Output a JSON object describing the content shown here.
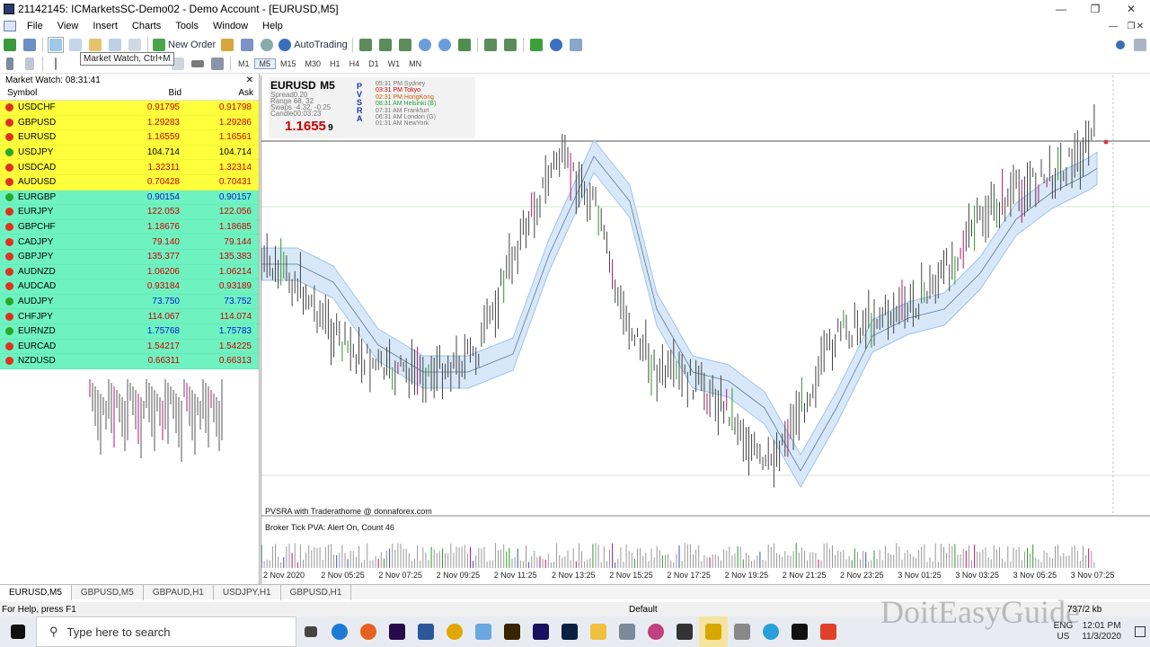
{
  "window": {
    "title": "21142145: ICMarketsSC-Demo02 - Demo Account - [EURUSD,M5]"
  },
  "menu": [
    "File",
    "View",
    "Insert",
    "Charts",
    "Tools",
    "Window",
    "Help"
  ],
  "toolbar": {
    "new_order": "New Order",
    "autotrading": "AutoTrading",
    "tooltip": "Market Watch, Ctrl+M"
  },
  "timeframes": [
    "M1",
    "M5",
    "M15",
    "M30",
    "H1",
    "H4",
    "D1",
    "W1",
    "MN"
  ],
  "market_watch": {
    "title": "Market Watch: 08:31:41",
    "headers": {
      "symbol": "Symbol",
      "bid": "Bid",
      "ask": "Ask"
    },
    "rows": [
      {
        "symbol": "USDCHF",
        "bid": "0.91795",
        "ask": "0.91798",
        "bg": "#ffff3b",
        "bid_color": "#c00",
        "ask_color": "#c00",
        "dir": "down"
      },
      {
        "symbol": "GBPUSD",
        "bid": "1.29283",
        "ask": "1.29286",
        "bg": "#ffff3b",
        "bid_color": "#c00",
        "ask_color": "#c00",
        "dir": "down"
      },
      {
        "symbol": "EURUSD",
        "bid": "1.16559",
        "ask": "1.16561",
        "bg": "#ffff3b",
        "bid_color": "#c00",
        "ask_color": "#c00",
        "dir": "down"
      },
      {
        "symbol": "USDJPY",
        "bid": "104.714",
        "ask": "104.714",
        "bg": "#ffff3b",
        "bid_color": "#000",
        "ask_color": "#000",
        "dir": "up"
      },
      {
        "symbol": "USDCAD",
        "bid": "1.32311",
        "ask": "1.32314",
        "bg": "#ffff3b",
        "bid_color": "#c00",
        "ask_color": "#c00",
        "dir": "down"
      },
      {
        "symbol": "AUDUSD",
        "bid": "0.70428",
        "ask": "0.70431",
        "bg": "#ffff3b",
        "bid_color": "#c00",
        "ask_color": "#c00",
        "dir": "down"
      },
      {
        "symbol": "EURGBP",
        "bid": "0.90154",
        "ask": "0.90157",
        "bg": "#6ef2c0",
        "bid_color": "#0019d8",
        "ask_color": "#0019d8",
        "dir": "up"
      },
      {
        "symbol": "EURJPY",
        "bid": "122.053",
        "ask": "122.056",
        "bg": "#6ef2c0",
        "bid_color": "#c00",
        "ask_color": "#c00",
        "dir": "down"
      },
      {
        "symbol": "GBPCHF",
        "bid": "1.18676",
        "ask": "1.18685",
        "bg": "#6ef2c0",
        "bid_color": "#c00",
        "ask_color": "#c00",
        "dir": "down"
      },
      {
        "symbol": "CADJPY",
        "bid": "79.140",
        "ask": "79.144",
        "bg": "#6ef2c0",
        "bid_color": "#c00",
        "ask_color": "#c00",
        "dir": "down"
      },
      {
        "symbol": "GBPJPY",
        "bid": "135.377",
        "ask": "135.383",
        "bg": "#6ef2c0",
        "bid_color": "#c00",
        "ask_color": "#c00",
        "dir": "down"
      },
      {
        "symbol": "AUDNZD",
        "bid": "1.06206",
        "ask": "1.06214",
        "bg": "#6ef2c0",
        "bid_color": "#c00",
        "ask_color": "#c00",
        "dir": "down"
      },
      {
        "symbol": "AUDCAD",
        "bid": "0.93184",
        "ask": "0.93189",
        "bg": "#6ef2c0",
        "bid_color": "#c00",
        "ask_color": "#c00",
        "dir": "down"
      },
      {
        "symbol": "AUDJPY",
        "bid": "73.750",
        "ask": "73.752",
        "bg": "#6ef2c0",
        "bid_color": "#0019d8",
        "ask_color": "#0019d8",
        "dir": "up"
      },
      {
        "symbol": "CHFJPY",
        "bid": "114.067",
        "ask": "114.074",
        "bg": "#6ef2c0",
        "bid_color": "#c00",
        "ask_color": "#c00",
        "dir": "down"
      },
      {
        "symbol": "EURNZD",
        "bid": "1.75768",
        "ask": "1.75783",
        "bg": "#6ef2c0",
        "bid_color": "#0019d8",
        "ask_color": "#0019d8",
        "dir": "up"
      },
      {
        "symbol": "EURCAD",
        "bid": "1.54217",
        "ask": "1.54225",
        "bg": "#6ef2c0",
        "bid_color": "#c00",
        "ask_color": "#c00",
        "dir": "down"
      },
      {
        "symbol": "NZDUSD",
        "bid": "0.66311",
        "ask": "0.66313",
        "bg": "#6ef2c0",
        "bid_color": "#c00",
        "ask_color": "#c00",
        "dir": "down"
      }
    ]
  },
  "chart": {
    "symbol": "EURUSD",
    "timeframe": "M5",
    "spread": "Spread0.20",
    "range": "Range 68, 32",
    "swaps": "Swaps -4.32, -0.25",
    "candle": "Candle00:03:23",
    "price": "1.1655",
    "price_suffix": "9",
    "pvsra": [
      "P",
      "V",
      "S",
      "R",
      "A"
    ],
    "sessions": [
      "05:31 PM Sydney",
      "03:31 PM Tokyo",
      "02:31 PM HongKong",
      "08:31 AM Helsinki (B)",
      "07:31 AM Frankfurt",
      "06:31 AM London (G)",
      "01:31 AM NewYork"
    ],
    "caption": "PVSRA with Traderathome @ donnaforex.com",
    "subwindow": "Broker Tick PVA:   Alert On,  Count  46",
    "time_axis": [
      "2 Nov 2020",
      "2 Nov 05:25",
      "2 Nov 07:25",
      "2 Nov 09:25",
      "2 Nov 11:25",
      "2 Nov 13:25",
      "2 Nov 15:25",
      "2 Nov 17:25",
      "2 Nov 19:25",
      "2 Nov 21:25",
      "2 Nov 23:25",
      "3 Nov 01:25",
      "3 Nov 03:25",
      "3 Nov 05:25",
      "3 Nov 07:25"
    ]
  },
  "chart_tabs": [
    "EURUSD,M5",
    "GBPUSD,M5",
    "GBPAUD,H1",
    "USDJPY,H1",
    "GBPUSD,H1"
  ],
  "status": {
    "help": "For Help, press F1",
    "profile": "Default",
    "traffic": "737/2 kb"
  },
  "taskbar": {
    "search_placeholder": "Type here to search",
    "lang": "ENG",
    "region": "US",
    "time": "12:01 PM",
    "date": "11/3/2020"
  },
  "watermark": "DoitEasyGuide"
}
